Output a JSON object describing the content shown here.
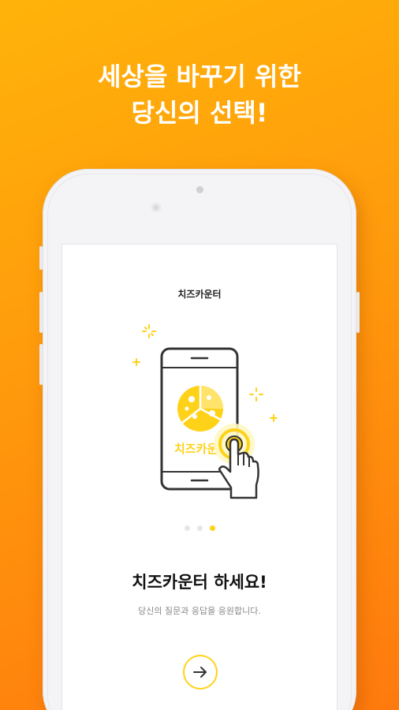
{
  "headline": {
    "line1": "세상을 바꾸기 위한",
    "line2": "당신의 선택!"
  },
  "screen": {
    "app_title": "치즈카운터",
    "illustration_label": "치즈카운",
    "main_title": "치즈카운터 하세요!",
    "subtitle": "당신의 질문과 응답을 응원합니다.",
    "page_indicator": {
      "total": 3,
      "current": 3
    }
  },
  "colors": {
    "background_start": "#ffb30a",
    "background_end": "#ff7a0e",
    "accent_yellow": "#ffd21a",
    "text_dark": "#111111",
    "text_muted": "#888888"
  },
  "icons": {
    "next": "arrow-right-icon",
    "tap": "hand-pointer-icon",
    "pizza": "cheese-pizza-icon"
  }
}
